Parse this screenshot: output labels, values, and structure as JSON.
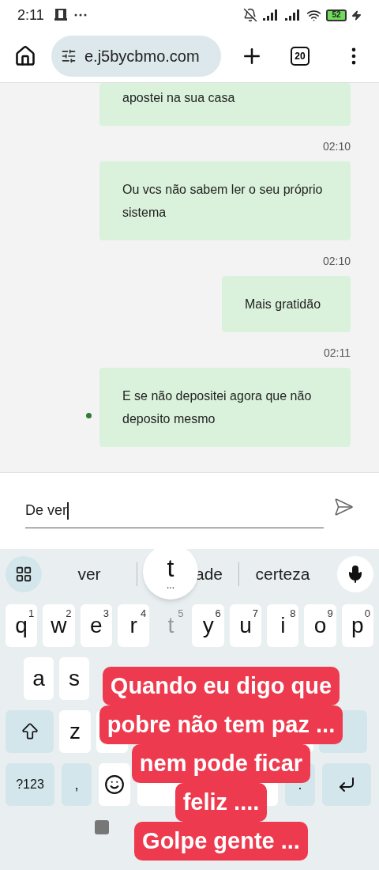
{
  "status_bar": {
    "time": "2:11",
    "battery": "52"
  },
  "browser_bar": {
    "url": "e.j5bycbmo.com",
    "tab_count": "20"
  },
  "chat": [
    {
      "kind": "bubble",
      "text": "apostei na sua casa",
      "wide": true,
      "dot": false
    },
    {
      "kind": "time",
      "text": "02:10"
    },
    {
      "kind": "bubble",
      "text": "Ou vcs não sabem ler o seu próprio sistema",
      "wide": true,
      "dot": false
    },
    {
      "kind": "time",
      "text": "02:10"
    },
    {
      "kind": "bubble",
      "text": "Mais gratidão",
      "wide": false,
      "dot": false
    },
    {
      "kind": "time",
      "text": "02:11"
    },
    {
      "kind": "bubble",
      "text": "E se não depositei agora que não deposito mesmo",
      "wide": true,
      "dot": true
    }
  ],
  "composer": {
    "value": "De ver"
  },
  "keyboard": {
    "suggestions": [
      "ver",
      "ade",
      "certeza"
    ],
    "popup": {
      "letter": "t",
      "more": "..."
    },
    "row1": [
      {
        "label": "q",
        "hint": "1",
        "pressed": false
      },
      {
        "label": "w",
        "hint": "2",
        "pressed": false
      },
      {
        "label": "e",
        "hint": "3",
        "pressed": false
      },
      {
        "label": "r",
        "hint": "4",
        "pressed": false
      },
      {
        "label": "t",
        "hint": "5",
        "pressed": true
      },
      {
        "label": "y",
        "hint": "6",
        "pressed": false
      },
      {
        "label": "u",
        "hint": "7",
        "pressed": false
      },
      {
        "label": "i",
        "hint": "8",
        "pressed": false
      },
      {
        "label": "o",
        "hint": "9",
        "pressed": false
      },
      {
        "label": "p",
        "hint": "0",
        "pressed": false
      }
    ],
    "row2": [
      "a",
      "s"
    ],
    "row3": [
      "z"
    ],
    "symbols_key": "?123",
    "comma_key": ",",
    "period_key": "."
  },
  "caption": [
    "Quando eu digo que",
    "pobre não tem paz ...",
    "nem pode ficar",
    "feliz ....",
    "Golpe gente ..."
  ]
}
